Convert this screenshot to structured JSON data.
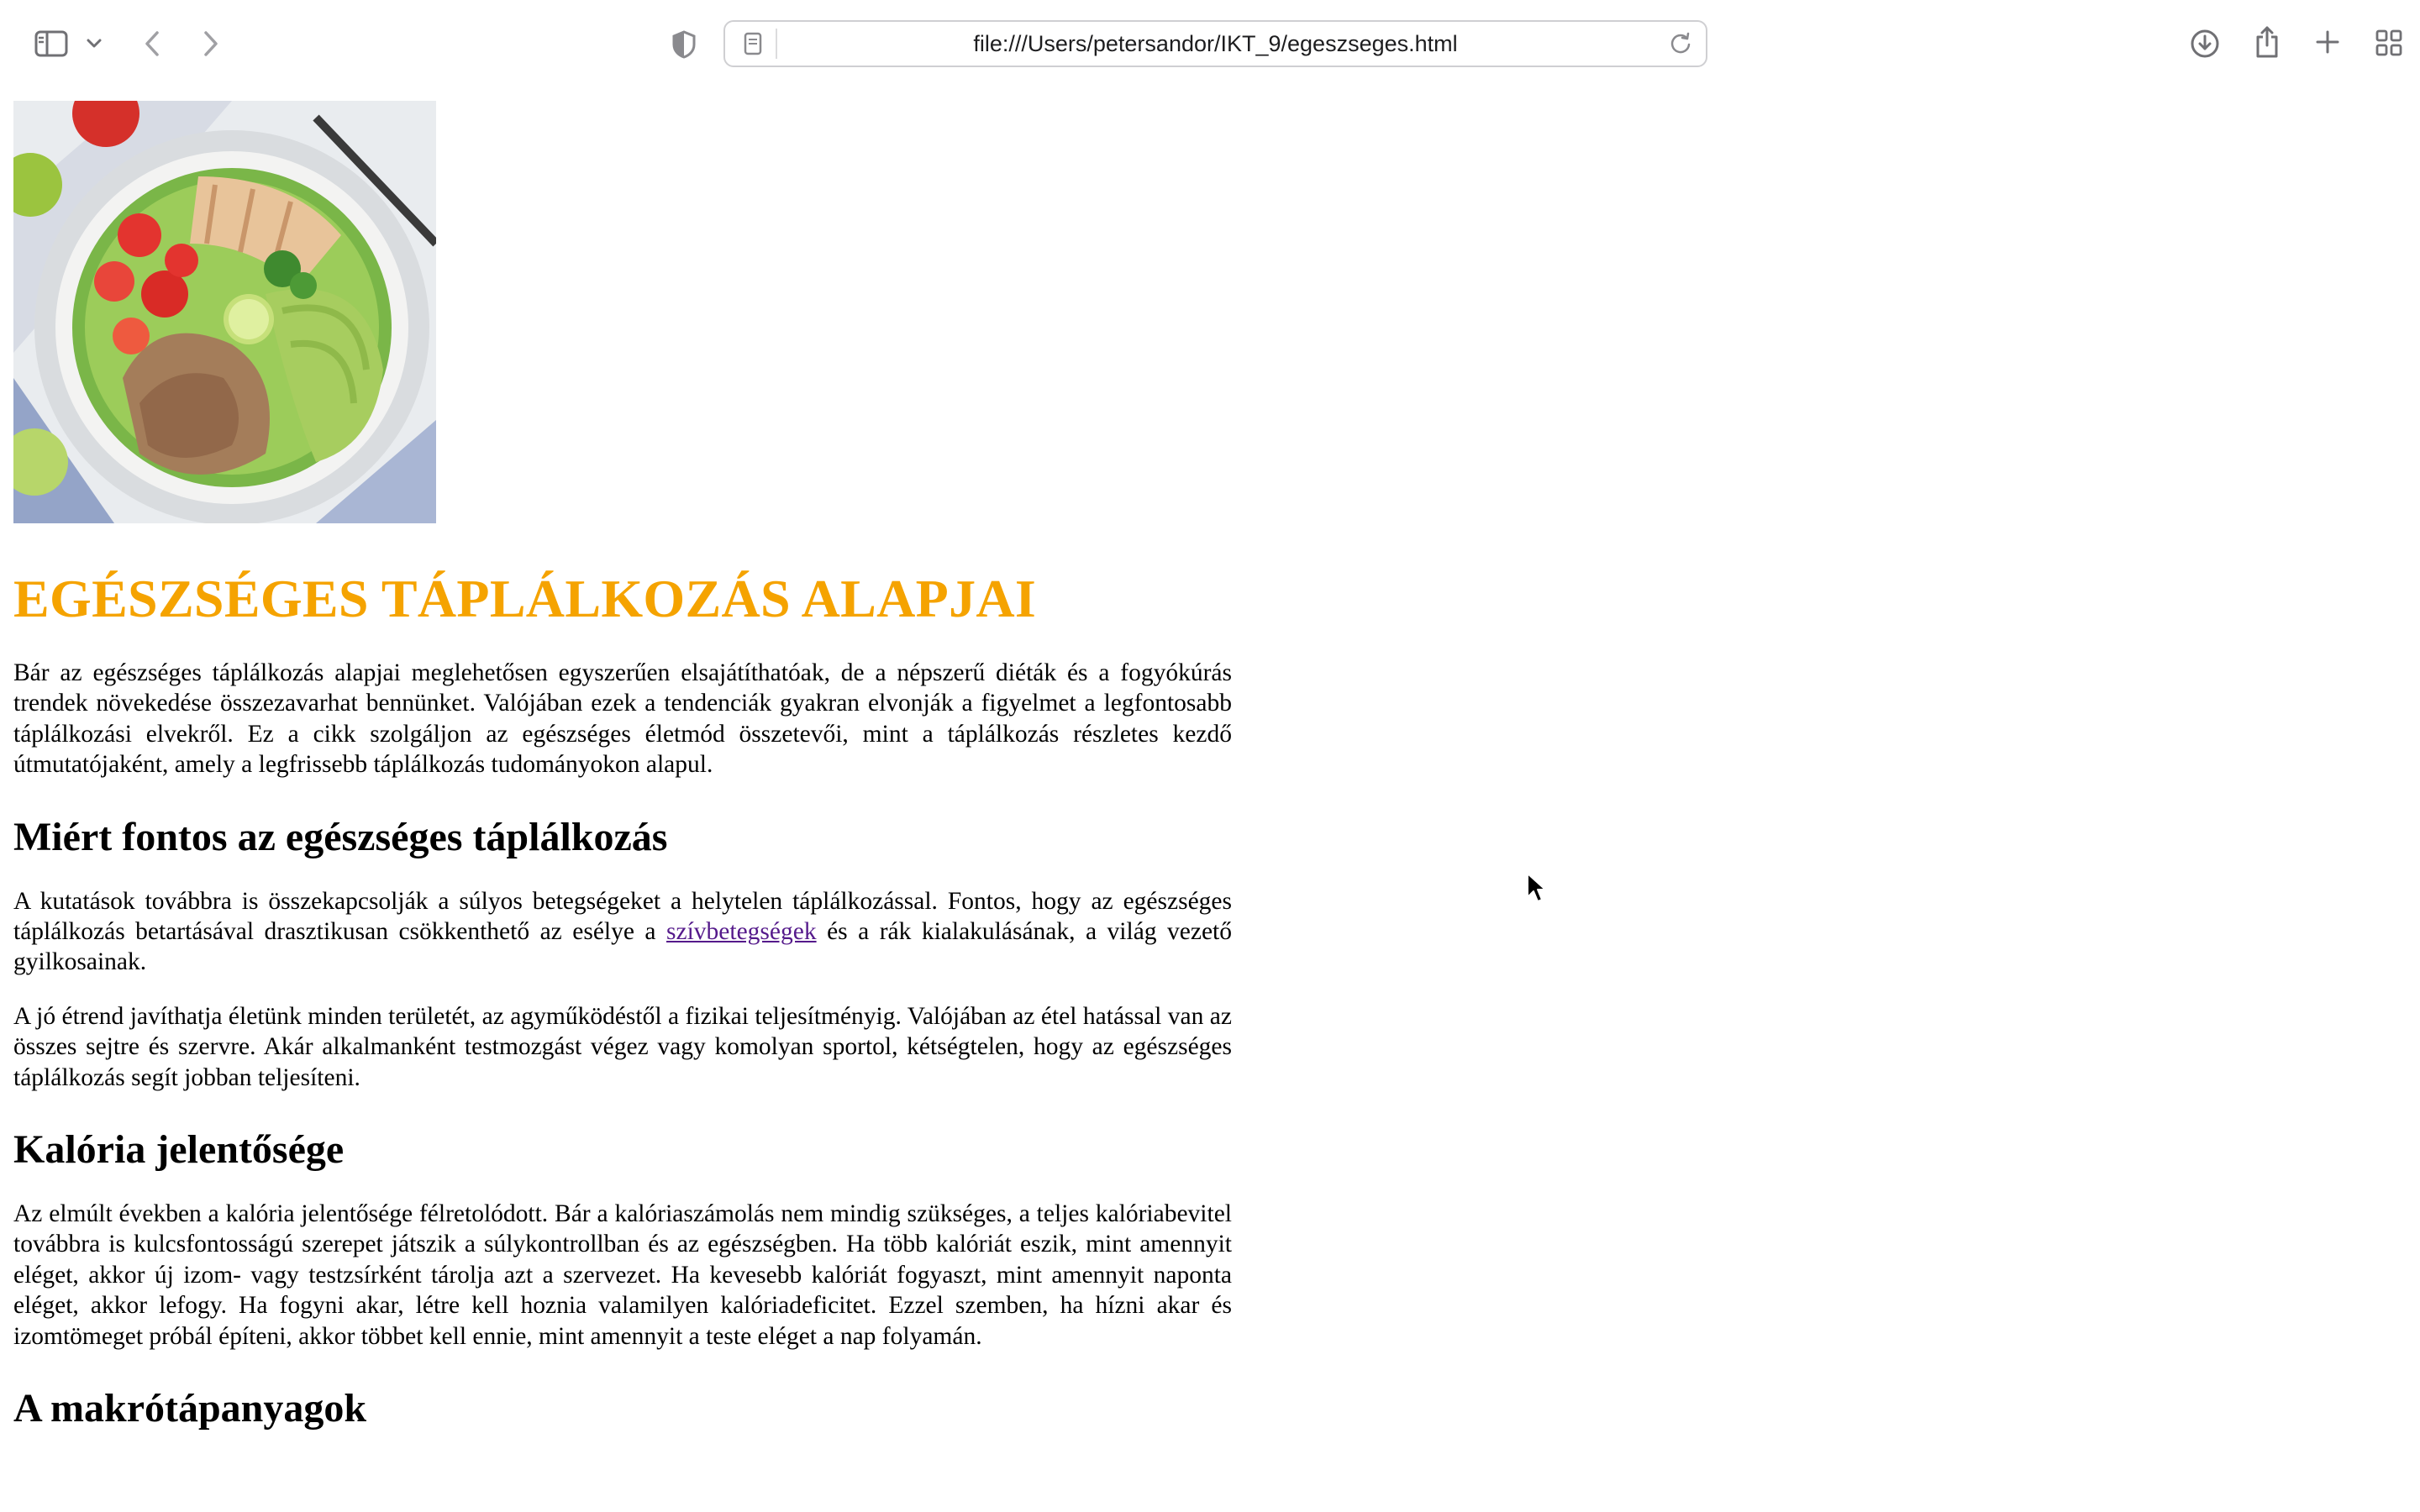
{
  "browser": {
    "url": "file:///Users/petersandor/IKT_9/egeszseges.html",
    "icons": [
      "sidebar-icon",
      "chevron-down-icon",
      "back-icon",
      "forward-icon",
      "privacy-shield-icon",
      "page-icon",
      "reload-icon",
      "download-icon",
      "share-icon",
      "new-tab-icon",
      "tab-overview-icon"
    ]
  },
  "article": {
    "image_alt": "healthy salad bowl",
    "title": "EGÉSZSÉGES TÁPLÁLKOZÁS ALAPJAI",
    "intro": "Bár az egészséges táplálkozás alapjai meglehetősen egyszerűen elsajátíthatóak, de a népszerű diéták és a fogyókúrás trendek növekedése összezavarhat bennünket. Valójában ezek a tendenciák gyakran elvonják a figyelmet a legfontosabb táplálkozási elvekről. Ez a cikk szolgáljon az egészséges életmód összetevői, mint a táplálkozás részletes kezdő útmutatójaként, amely a legfrissebb táplálkozás tudományokon alapul.",
    "section1": {
      "heading": "Miért fontos az egészséges táplálkozás",
      "p1_before": "A kutatások továbbra is összekapcsolják a súlyos betegségeket a helytelen táplálkozással. Fontos, hogy az egészséges táplálkozás betartásával drasztikusan csökkenthető az esélye a ",
      "p1_link": "szívbetegségek",
      "p1_after": " és a rák kialakulásának, a világ vezető gyilkosainak.",
      "p2": "A jó étrend javíthatja életünk minden területét, az agyműködéstől a fizikai teljesítményig. Valójában az étel hatással van az összes sejtre és szervre. Akár alkalmanként testmozgást végez vagy komolyan sportol, kétségtelen, hogy az egészséges táplálkozás segít jobban teljesíteni."
    },
    "section2": {
      "heading": "Kalória jelentősége",
      "p1": "Az elmúlt években a kalória jelentősége félretolódott. Bár a kalóriaszámolás nem mindig szükséges, a teljes kalóriabevitel továbbra is kulcsfontosságú szerepet játszik a súlykontrollban és az egészségben. Ha több kalóriát eszik, mint amennyit eléget, akkor új izom- vagy testzsírként tárolja azt a szervezet. Ha kevesebb kalóriát fogyaszt, mint amennyit naponta eléget, akkor lefogy. Ha fogyni akar, létre kell hoznia valamilyen kalóriadeficitet. Ezzel szemben, ha hízni akar és izomtömeget próbál építeni, akkor többet kell ennie, mint amennyit a teste eléget a nap folyamán."
    },
    "section3": {
      "heading": "A makrótápanyagok"
    }
  },
  "colors": {
    "title": "#f5a300",
    "link_visited": "#551a8b"
  }
}
